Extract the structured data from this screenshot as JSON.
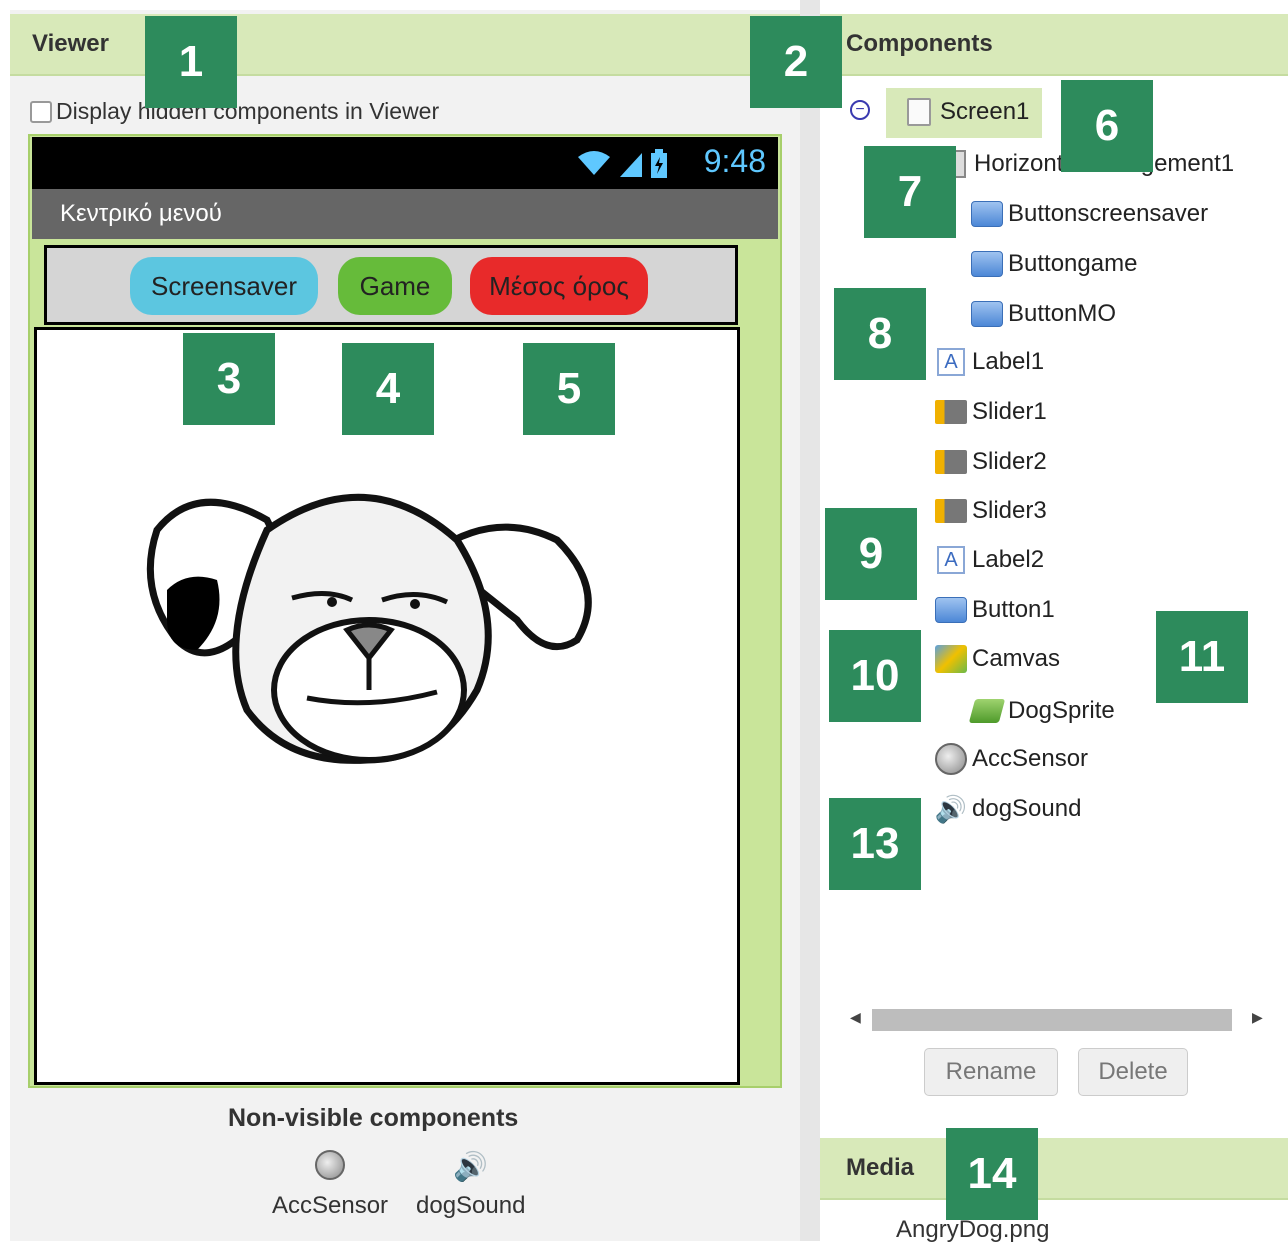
{
  "viewer": {
    "title": "Viewer",
    "checkbox_label": "Display hidden components in Viewer",
    "status_time": "9:48",
    "screen_title": "Κεντρικό μενού",
    "buttons": [
      {
        "label": "Screensaver",
        "color": "#5cc6e0"
      },
      {
        "label": "Game",
        "color": "#66bb3a"
      },
      {
        "label": "Μέσος όρος",
        "color": "#e82a2a"
      }
    ],
    "nonvisible_title": "Non-visible components",
    "nonvisible_items": [
      {
        "label": "AccSensor",
        "icon": "accelerometer-icon"
      },
      {
        "label": "dogSound",
        "icon": "speaker-icon"
      }
    ]
  },
  "components": {
    "title": "Components",
    "tree": [
      {
        "label": "Screen1",
        "icon": "screen-icon",
        "selected": true
      },
      {
        "label": "HorizontalArrangement1",
        "icon": "horizontal-arrangement-icon"
      },
      {
        "label": "Buttonscreensaver",
        "icon": "button-icon"
      },
      {
        "label": "Buttongame",
        "icon": "button-icon"
      },
      {
        "label": "ButtonMO",
        "icon": "button-icon"
      },
      {
        "label": "Label1",
        "icon": "label-icon"
      },
      {
        "label": "Slider1",
        "icon": "slider-icon"
      },
      {
        "label": "Slider2",
        "icon": "slider-icon"
      },
      {
        "label": "Slider3",
        "icon": "slider-icon"
      },
      {
        "label": "Label2",
        "icon": "label-icon"
      },
      {
        "label": "Button1",
        "icon": "button-icon"
      },
      {
        "label": "Camvas",
        "icon": "canvas-icon"
      },
      {
        "label": "DogSprite",
        "icon": "image-sprite-icon"
      },
      {
        "label": "AccSensor",
        "icon": "accelerometer-icon"
      },
      {
        "label": "dogSound",
        "icon": "speaker-icon"
      }
    ],
    "rename_label": "Rename",
    "delete_label": "Delete"
  },
  "media": {
    "title": "Media",
    "files": [
      "AngryDog.png"
    ]
  },
  "callouts": [
    "1",
    "2",
    "3",
    "4",
    "5",
    "6",
    "7",
    "8",
    "9",
    "10",
    "11",
    "13",
    "14"
  ],
  "colors": {
    "header_green": "#d8e9b9",
    "badge_green": "#2d8b5c",
    "frame_green": "#c9e59a"
  }
}
